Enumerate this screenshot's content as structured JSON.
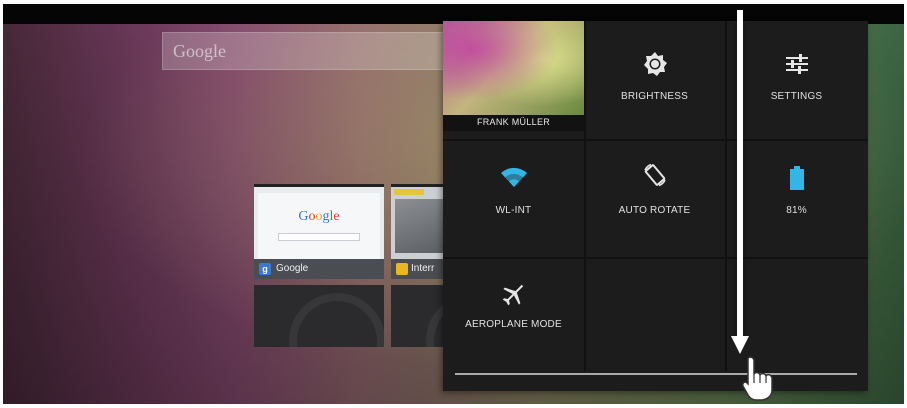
{
  "home": {
    "search_label": "Google",
    "tabs": [
      {
        "label": "Google",
        "logo_text": "Google"
      },
      {
        "label": "Interr"
      }
    ]
  },
  "quick_settings": {
    "user": {
      "name": "FRANK MÜLLER"
    },
    "tiles": [
      {
        "label": "BRIGHTNESS",
        "icon": "brightness-icon"
      },
      {
        "label": "SETTINGS",
        "icon": "settings-sliders-icon"
      },
      {
        "label": "WL-INT",
        "icon": "wifi-icon"
      },
      {
        "label": "AUTO ROTATE",
        "icon": "auto-rotate-icon"
      },
      {
        "label": "81%",
        "icon": "battery-icon"
      },
      {
        "label": "AEROPLANE MODE",
        "icon": "airplane-icon"
      }
    ],
    "colors": {
      "panel": "#1c1c1c",
      "wifi": "#33b5e5",
      "battery": "#33b5e5"
    }
  },
  "gesture": {
    "direction": "swipe-down",
    "icon": "hand-pointer-icon"
  }
}
